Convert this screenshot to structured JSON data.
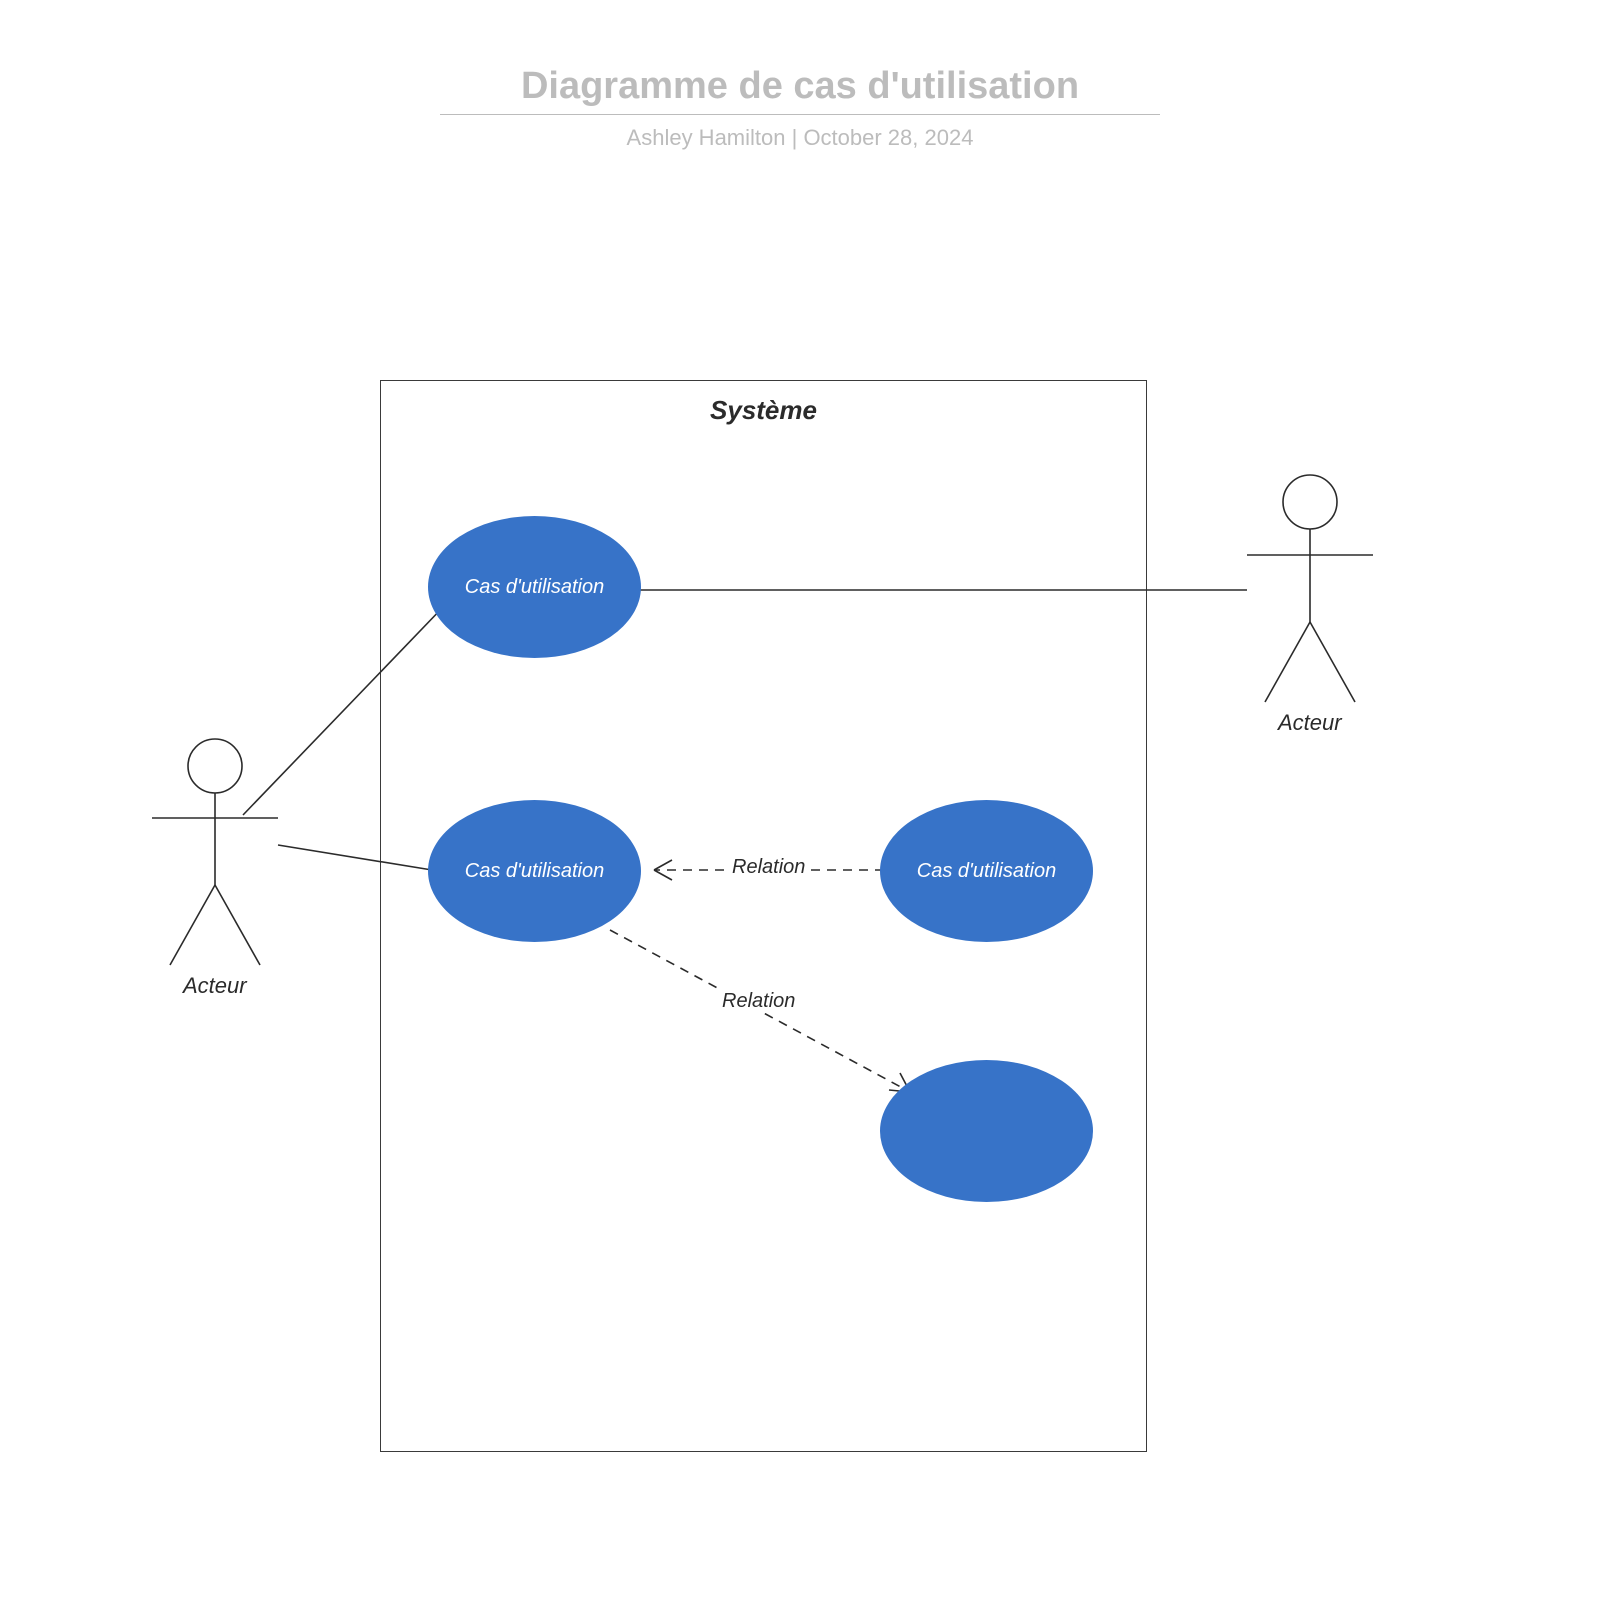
{
  "header": {
    "title": "Diagramme de cas d'utilisation",
    "author": "Ashley Hamilton",
    "separator": "  |  ",
    "date": "October 28, 2024"
  },
  "system": {
    "title": "Système"
  },
  "actors": {
    "left": {
      "label": "Acteur"
    },
    "right": {
      "label": "Acteur"
    }
  },
  "usecases": {
    "uc1": {
      "label": "Cas d'utilisation"
    },
    "uc2": {
      "label": "Cas d'utilisation"
    },
    "uc3": {
      "label": "Cas d'utilisation"
    },
    "uc4": {
      "label": ""
    }
  },
  "relations": {
    "r1": {
      "label": "Relation"
    },
    "r2": {
      "label": "Relation"
    }
  }
}
